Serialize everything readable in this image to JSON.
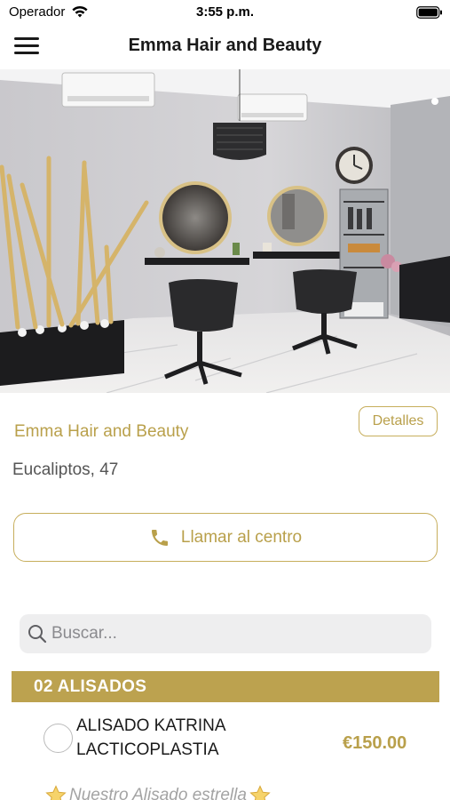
{
  "status_bar": {
    "carrier": "Operador",
    "time": "3:55 p.m."
  },
  "nav": {
    "title": "Emma Hair and Beauty",
    "menu_icon": "hamburger-menu-icon"
  },
  "hero": {
    "description_icon": "salon-photo"
  },
  "center": {
    "name": "Emma Hair and Beauty",
    "details_label": "Detalles",
    "address": "Eucaliptos, 47",
    "call_label": "Llamar al centro",
    "call_icon": "phone-icon"
  },
  "search": {
    "placeholder": "Buscar...",
    "value": ""
  },
  "category": {
    "title": "02 ALISADOS"
  },
  "service": {
    "name": "ALISADO KATRINA LACTICOPLASTIA",
    "price": "€150.00",
    "selected": false,
    "note": "Nuestro Alisado estrella"
  },
  "colors": {
    "accent_gold": "#b9a04b",
    "category_bar": "#bca24f",
    "search_bg": "#eeeeef"
  }
}
